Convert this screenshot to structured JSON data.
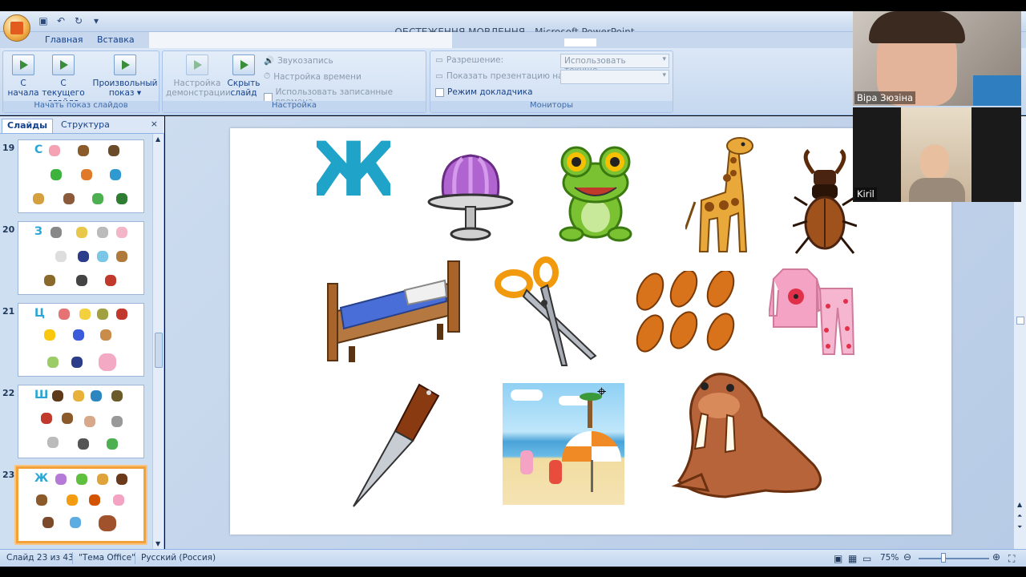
{
  "window": {
    "title": "ОБСТЕЖЕННЯ МОВЛЕННЯ - Microsoft PowerPoint"
  },
  "ribbon_tabs": [
    "Главная",
    "Вставка"
  ],
  "ribbon": {
    "start_group": {
      "label": "Начать показ слайдов",
      "from_start": "С\nначала",
      "from_current": "С текущего\nслайда",
      "custom": "Произвольный\nпоказ ▾"
    },
    "setup_group": {
      "label": "Настройка",
      "setup_show": "Настройка\nдемонстрации",
      "hide_slide": "Скрыть\nслайд",
      "record_narration": "Звукозапись",
      "rehearse_timings": "Настройка времени",
      "use_timings": "Использовать записанные времена"
    },
    "monitors_group": {
      "label": "Мониторы",
      "resolution": "Разрешение:",
      "resolution_value": "Использовать текуще...",
      "show_on": "Показать презентацию на:",
      "presenter_view": "Режим докладчика"
    }
  },
  "left_panel": {
    "tab_slides": "Слайды",
    "tab_outline": "Структура",
    "close": "×",
    "thumbnails": [
      {
        "num": "19",
        "letter": "С",
        "selected": false
      },
      {
        "num": "20",
        "letter": "З",
        "selected": false
      },
      {
        "num": "21",
        "letter": "Ц",
        "selected": false
      },
      {
        "num": "22",
        "letter": "Ш",
        "selected": false
      },
      {
        "num": "23",
        "letter": "Ж",
        "selected": true
      }
    ]
  },
  "slide": {
    "letter": "Ж",
    "pictures": [
      "letter-zh",
      "jelly",
      "frog",
      "giraffe",
      "stag-beetle",
      "bed",
      "scissors",
      "pies",
      "pajamas",
      "knife",
      "beach",
      "walrus"
    ]
  },
  "status_bar": {
    "slide_info": "Слайд 23 из 43",
    "theme": "\"Тема Office\"",
    "language": "Русский (Россия)",
    "zoom": "75%"
  },
  "video": {
    "participant1": "Віра Зюзіна",
    "participant2": "Kiril"
  },
  "colors": {
    "ribbon_blue": "#c5d8ef",
    "accent_orange": "#f3a13a",
    "letter_cyan": "#2aa6d6"
  }
}
